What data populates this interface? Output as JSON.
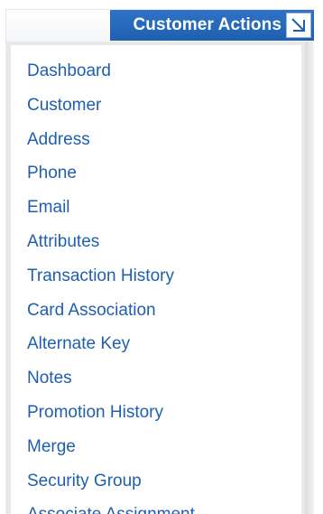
{
  "header": {
    "title": "Customer Actions",
    "collapse_icon": "arrow-down-right-icon"
  },
  "menu": {
    "items": [
      "Dashboard",
      "Customer",
      "Address",
      "Phone",
      "Email",
      "Attributes",
      "Transaction History",
      "Card Association",
      "Alternate Key",
      "Notes",
      "Promotion History",
      "Merge",
      "Security Group",
      "Associate Assignment"
    ]
  },
  "colors": {
    "header_bg": "#2a6bbf",
    "link": "#1f5fb0",
    "panel_border": "#e9e9e9"
  }
}
